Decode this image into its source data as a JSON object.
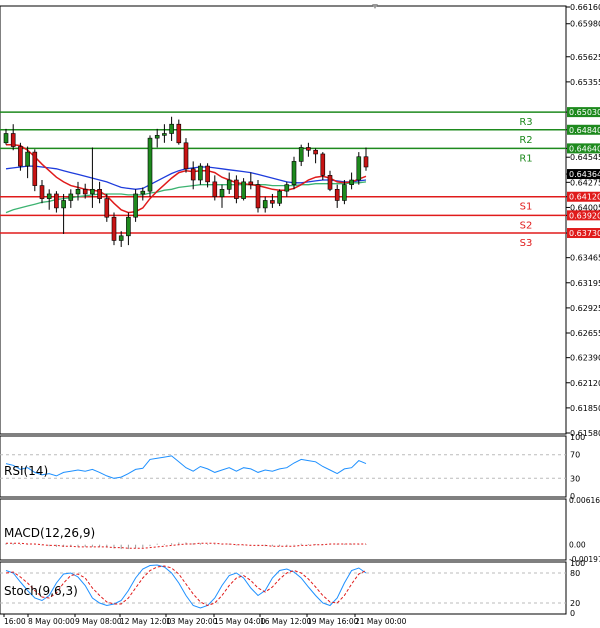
{
  "chart_data": {
    "type": "candlestick",
    "main": {
      "price_ticks": [
        "0.66160",
        "0.65980",
        "0.65625",
        "0.65355",
        "0.65030",
        "0.64840",
        "0.64640",
        "0.64545",
        "0.64364",
        "0.64275",
        "0.64120",
        "0.64005",
        "0.63920",
        "0.63730",
        "0.63465",
        "0.63195",
        "0.62925",
        "0.62655",
        "0.62390",
        "0.62120",
        "0.61850",
        "0.61580"
      ],
      "price_range": [
        0.6158,
        0.6616
      ],
      "time_labels": [
        "16:00",
        "8 May 00:00",
        "9 May 08:00",
        "12 May 12:00",
        "13 May 20:00",
        "15 May 04:00",
        "16 May 12:00",
        "19 May 16:00",
        "21 May 00:00"
      ],
      "levels": [
        {
          "label": "R3",
          "value": 0.6503,
          "price_label": "0.65030",
          "color": "#1e8a1e"
        },
        {
          "label": "R2",
          "value": 0.6484,
          "price_label": "0.64840",
          "color": "#1e8a1e"
        },
        {
          "label": "R1",
          "value": 0.6464,
          "price_label": "0.64640",
          "color": "#1e8a1e"
        },
        {
          "label": "S1",
          "value": 0.6412,
          "price_label": "0.64120",
          "color": "#e01b1b"
        },
        {
          "label": "S2",
          "value": 0.6392,
          "price_label": "0.63920",
          "color": "#e01b1b"
        },
        {
          "label": "S3",
          "value": 0.6373,
          "price_label": "0.63730",
          "color": "#e01b1b"
        }
      ],
      "current_price": {
        "value": 0.64364,
        "label": "0.64364"
      },
      "candles": [
        [
          0.647,
          0.6485,
          0.6468,
          0.648
        ],
        [
          0.648,
          0.649,
          0.6462,
          0.6466
        ],
        [
          0.6466,
          0.647,
          0.644,
          0.6445
        ],
        [
          0.6445,
          0.6466,
          0.6432,
          0.646
        ],
        [
          0.646,
          0.6463,
          0.6418,
          0.6424
        ],
        [
          0.6424,
          0.643,
          0.6405,
          0.641
        ],
        [
          0.641,
          0.642,
          0.6398,
          0.6415
        ],
        [
          0.6415,
          0.6418,
          0.6395,
          0.64
        ],
        [
          0.64,
          0.6415,
          0.6372,
          0.6408
        ],
        [
          0.6408,
          0.642,
          0.64,
          0.6415
        ],
        [
          0.6415,
          0.6428,
          0.6408,
          0.642
        ],
        [
          0.642,
          0.6426,
          0.641,
          0.6415
        ],
        [
          0.6415,
          0.6465,
          0.64,
          0.642
        ],
        [
          0.642,
          0.6428,
          0.6405,
          0.641
        ],
        [
          0.641,
          0.6415,
          0.6385,
          0.639
        ],
        [
          0.639,
          0.6395,
          0.636,
          0.6365
        ],
        [
          0.6365,
          0.6375,
          0.6358,
          0.637
        ],
        [
          0.637,
          0.6395,
          0.636,
          0.639
        ],
        [
          0.639,
          0.642,
          0.6385,
          0.6415
        ],
        [
          0.6415,
          0.6422,
          0.6408,
          0.6418
        ],
        [
          0.6418,
          0.6478,
          0.6412,
          0.6475
        ],
        [
          0.6475,
          0.6485,
          0.6465,
          0.6478
        ],
        [
          0.6478,
          0.649,
          0.647,
          0.648
        ],
        [
          0.648,
          0.6498,
          0.6472,
          0.649
        ],
        [
          0.649,
          0.6495,
          0.6468,
          0.647
        ],
        [
          0.647,
          0.6475,
          0.6438,
          0.6442
        ],
        [
          0.6442,
          0.645,
          0.642,
          0.643
        ],
        [
          0.643,
          0.6448,
          0.6425,
          0.6445
        ],
        [
          0.6445,
          0.6448,
          0.6422,
          0.6428
        ],
        [
          0.6428,
          0.6435,
          0.6408,
          0.6412
        ],
        [
          0.6412,
          0.6425,
          0.64,
          0.642
        ],
        [
          0.642,
          0.6438,
          0.6415,
          0.643
        ],
        [
          0.643,
          0.6435,
          0.6405,
          0.641
        ],
        [
          0.641,
          0.6432,
          0.6408,
          0.6428
        ],
        [
          0.6428,
          0.6438,
          0.642,
          0.6425
        ],
        [
          0.6425,
          0.643,
          0.6395,
          0.64
        ],
        [
          0.64,
          0.6412,
          0.6395,
          0.6408
        ],
        [
          0.6408,
          0.6415,
          0.64,
          0.6405
        ],
        [
          0.6405,
          0.642,
          0.6402,
          0.6418
        ],
        [
          0.6418,
          0.6428,
          0.6412,
          0.6425
        ],
        [
          0.6425,
          0.6455,
          0.642,
          0.645
        ],
        [
          0.645,
          0.6468,
          0.6445,
          0.6465
        ],
        [
          0.6465,
          0.647,
          0.6455,
          0.6462
        ],
        [
          0.6462,
          0.6464,
          0.6448,
          0.6458
        ],
        [
          0.6458,
          0.646,
          0.643,
          0.6435
        ],
        [
          0.6435,
          0.644,
          0.6418,
          0.642
        ],
        [
          0.642,
          0.6425,
          0.64,
          0.6408
        ],
        [
          0.6408,
          0.643,
          0.6404,
          0.6425
        ],
        [
          0.6425,
          0.6438,
          0.642,
          0.643
        ],
        [
          0.643,
          0.646,
          0.6425,
          0.6455
        ],
        [
          0.6455,
          0.6465,
          0.644,
          0.6444
        ]
      ],
      "ma_fast": [
        0.6468,
        0.6468,
        0.6467,
        0.6462,
        0.6455,
        0.6447,
        0.644,
        0.6433,
        0.6428,
        0.6424,
        0.6422,
        0.642,
        0.6419,
        0.6418,
        0.6413,
        0.6405,
        0.6398,
        0.6395,
        0.6396,
        0.64,
        0.641,
        0.6418,
        0.6425,
        0.6432,
        0.6438,
        0.644,
        0.6439,
        0.644,
        0.644,
        0.6438,
        0.6433,
        0.643,
        0.6427,
        0.6426,
        0.6425,
        0.6424,
        0.6422,
        0.642,
        0.6419,
        0.6419,
        0.6421,
        0.6425,
        0.643,
        0.6433,
        0.6434,
        0.6432,
        0.6428,
        0.6427,
        0.6428,
        0.6431,
        0.6434
      ],
      "ma_mid": [
        0.6442,
        0.6443,
        0.6444,
        0.6445,
        0.6445,
        0.6444,
        0.6443,
        0.6442,
        0.644,
        0.6438,
        0.6436,
        0.6434,
        0.6432,
        0.643,
        0.6428,
        0.6425,
        0.6422,
        0.6421,
        0.642,
        0.6421,
        0.6425,
        0.6429,
        0.6433,
        0.6437,
        0.644,
        0.6442,
        0.6443,
        0.6444,
        0.6444,
        0.6443,
        0.6442,
        0.6441,
        0.644,
        0.6439,
        0.6438,
        0.6436,
        0.6434,
        0.6432,
        0.643,
        0.6428,
        0.6427,
        0.6427,
        0.6428,
        0.6429,
        0.643,
        0.643,
        0.6429,
        0.6428,
        0.6428,
        0.6429,
        0.643
      ],
      "ma_slow": [
        0.6395,
        0.6398,
        0.64,
        0.6402,
        0.6404,
        0.6406,
        0.6407,
        0.6409,
        0.641,
        0.6411,
        0.6412,
        0.6413,
        0.6414,
        0.6415,
        0.6415,
        0.6415,
        0.6415,
        0.6414,
        0.6414,
        0.6414,
        0.6416,
        0.6417,
        0.6419,
        0.642,
        0.6422,
        0.6423,
        0.6424,
        0.6425,
        0.6425,
        0.6425,
        0.6425,
        0.6425,
        0.6425,
        0.6425,
        0.6425,
        0.6425,
        0.6425,
        0.6424,
        0.6424,
        0.6424,
        0.6424,
        0.6425,
        0.6425,
        0.6426,
        0.6426,
        0.6426,
        0.6426,
        0.6426,
        0.6427,
        0.6427,
        0.6428
      ]
    },
    "rsi": {
      "label": "RSI(14)",
      "ticks": [
        "100",
        "70",
        "30",
        "0"
      ],
      "range": [
        0,
        100
      ],
      "values": [
        55,
        52,
        45,
        48,
        40,
        36,
        38,
        34,
        40,
        42,
        44,
        42,
        45,
        40,
        34,
        30,
        32,
        38,
        45,
        47,
        62,
        64,
        66,
        68,
        58,
        48,
        42,
        50,
        46,
        40,
        44,
        48,
        42,
        48,
        46,
        40,
        44,
        42,
        46,
        48,
        56,
        62,
        60,
        58,
        50,
        44,
        38,
        46,
        48,
        60,
        55
      ]
    },
    "macd": {
      "label": "MACD(12,26,9)",
      "ticks": [
        "0.006161",
        "0.00",
        "-0.001971"
      ],
      "range": [
        -0.001971,
        0.006161
      ],
      "histogram": [
        0.0002,
        0.0002,
        0.0001,
        0.0001,
        0.0,
        -0.0001,
        -0.0002,
        -0.0003,
        -0.0003,
        -0.0003,
        -0.0003,
        -0.0003,
        -0.0003,
        -0.0003,
        -0.0004,
        -0.0005,
        -0.0006,
        -0.0006,
        -0.0005,
        -0.0004,
        -0.0002,
        0.0,
        0.0001,
        0.0002,
        0.0003,
        0.0003,
        0.0002,
        0.0002,
        0.0001,
        0.0001,
        0.0,
        0.0,
        -0.0001,
        -0.0001,
        -0.0001,
        -0.0002,
        -0.0002,
        -0.0002,
        -0.0002,
        -0.0002,
        -0.0001,
        0.0,
        0.0001,
        0.0001,
        0.0001,
        0.0,
        0.0,
        0.0,
        0.0,
        0.0001,
        0.0001
      ],
      "signal": [
        0.0002,
        0.0002,
        0.0002,
        0.0001,
        0.0001,
        0.0,
        -0.0001,
        -0.0001,
        -0.0002,
        -0.0002,
        -0.0003,
        -0.0003,
        -0.0003,
        -0.0003,
        -0.0003,
        -0.0004,
        -0.0004,
        -0.0005,
        -0.0005,
        -0.0005,
        -0.0004,
        -0.0003,
        -0.0002,
        -0.0001,
        0.0,
        0.0001,
        0.0001,
        0.0002,
        0.0002,
        0.0002,
        0.0001,
        0.0001,
        0.0,
        0.0,
        -0.0001,
        -0.0001,
        -0.0001,
        -0.0002,
        -0.0002,
        -0.0002,
        -0.0002,
        -0.0001,
        -0.0001,
        0.0,
        0.0,
        0.0001,
        0.0001,
        0.0001,
        0.0001,
        0.0001,
        0.0001
      ]
    },
    "stoch": {
      "label": "Stoch(9,6,3)",
      "ticks": [
        "100",
        "80",
        "20",
        "0"
      ],
      "range": [
        0,
        100
      ],
      "k": [
        85,
        80,
        62,
        45,
        30,
        25,
        35,
        60,
        78,
        80,
        72,
        55,
        30,
        20,
        15,
        18,
        25,
        45,
        70,
        88,
        95,
        96,
        92,
        80,
        60,
        35,
        15,
        10,
        15,
        30,
        55,
        75,
        80,
        70,
        50,
        35,
        45,
        70,
        85,
        88,
        82,
        70,
        52,
        35,
        20,
        15,
        30,
        60,
        85,
        90,
        80
      ],
      "d": [
        80,
        82,
        72,
        60,
        45,
        32,
        30,
        40,
        60,
        75,
        78,
        70,
        50,
        35,
        22,
        18,
        18,
        30,
        50,
        70,
        85,
        92,
        94,
        90,
        78,
        58,
        38,
        22,
        15,
        20,
        35,
        55,
        70,
        75,
        65,
        50,
        42,
        52,
        68,
        80,
        85,
        80,
        68,
        52,
        35,
        22,
        20,
        35,
        58,
        78,
        85
      ]
    }
  }
}
